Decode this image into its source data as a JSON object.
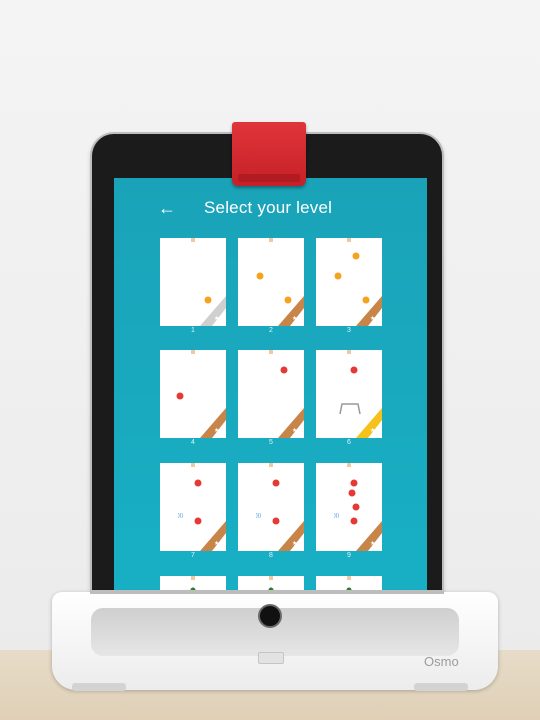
{
  "screen": {
    "title": "Select your level",
    "back_icon": "←"
  },
  "levels": [
    {
      "label": "1",
      "ramp": "gray"
    },
    {
      "label": "2",
      "ramp": "brown"
    },
    {
      "label": "3",
      "ramp": "brown"
    },
    {
      "label": "4",
      "ramp": "brown"
    },
    {
      "label": "5",
      "ramp": "brown"
    },
    {
      "label": "6",
      "ramp": "gold"
    },
    {
      "label": "7",
      "ramp": "brown"
    },
    {
      "label": "8",
      "ramp": "brown"
    },
    {
      "label": "9",
      "ramp": "brown"
    },
    {
      "label": "",
      "ramp": "none"
    },
    {
      "label": "",
      "ramp": "none"
    },
    {
      "label": "",
      "ramp": "none"
    }
  ],
  "device": {
    "brand": "Osmo"
  },
  "colors": {
    "screen_bg": "#18aac0",
    "clip_red": "#d32a30",
    "ramp_brown": "#c7854a",
    "ramp_gold": "#f4c21b",
    "ramp_gray": "#cfcfcf",
    "ball_orange": "#f4a41c",
    "ball_red": "#e53935"
  }
}
